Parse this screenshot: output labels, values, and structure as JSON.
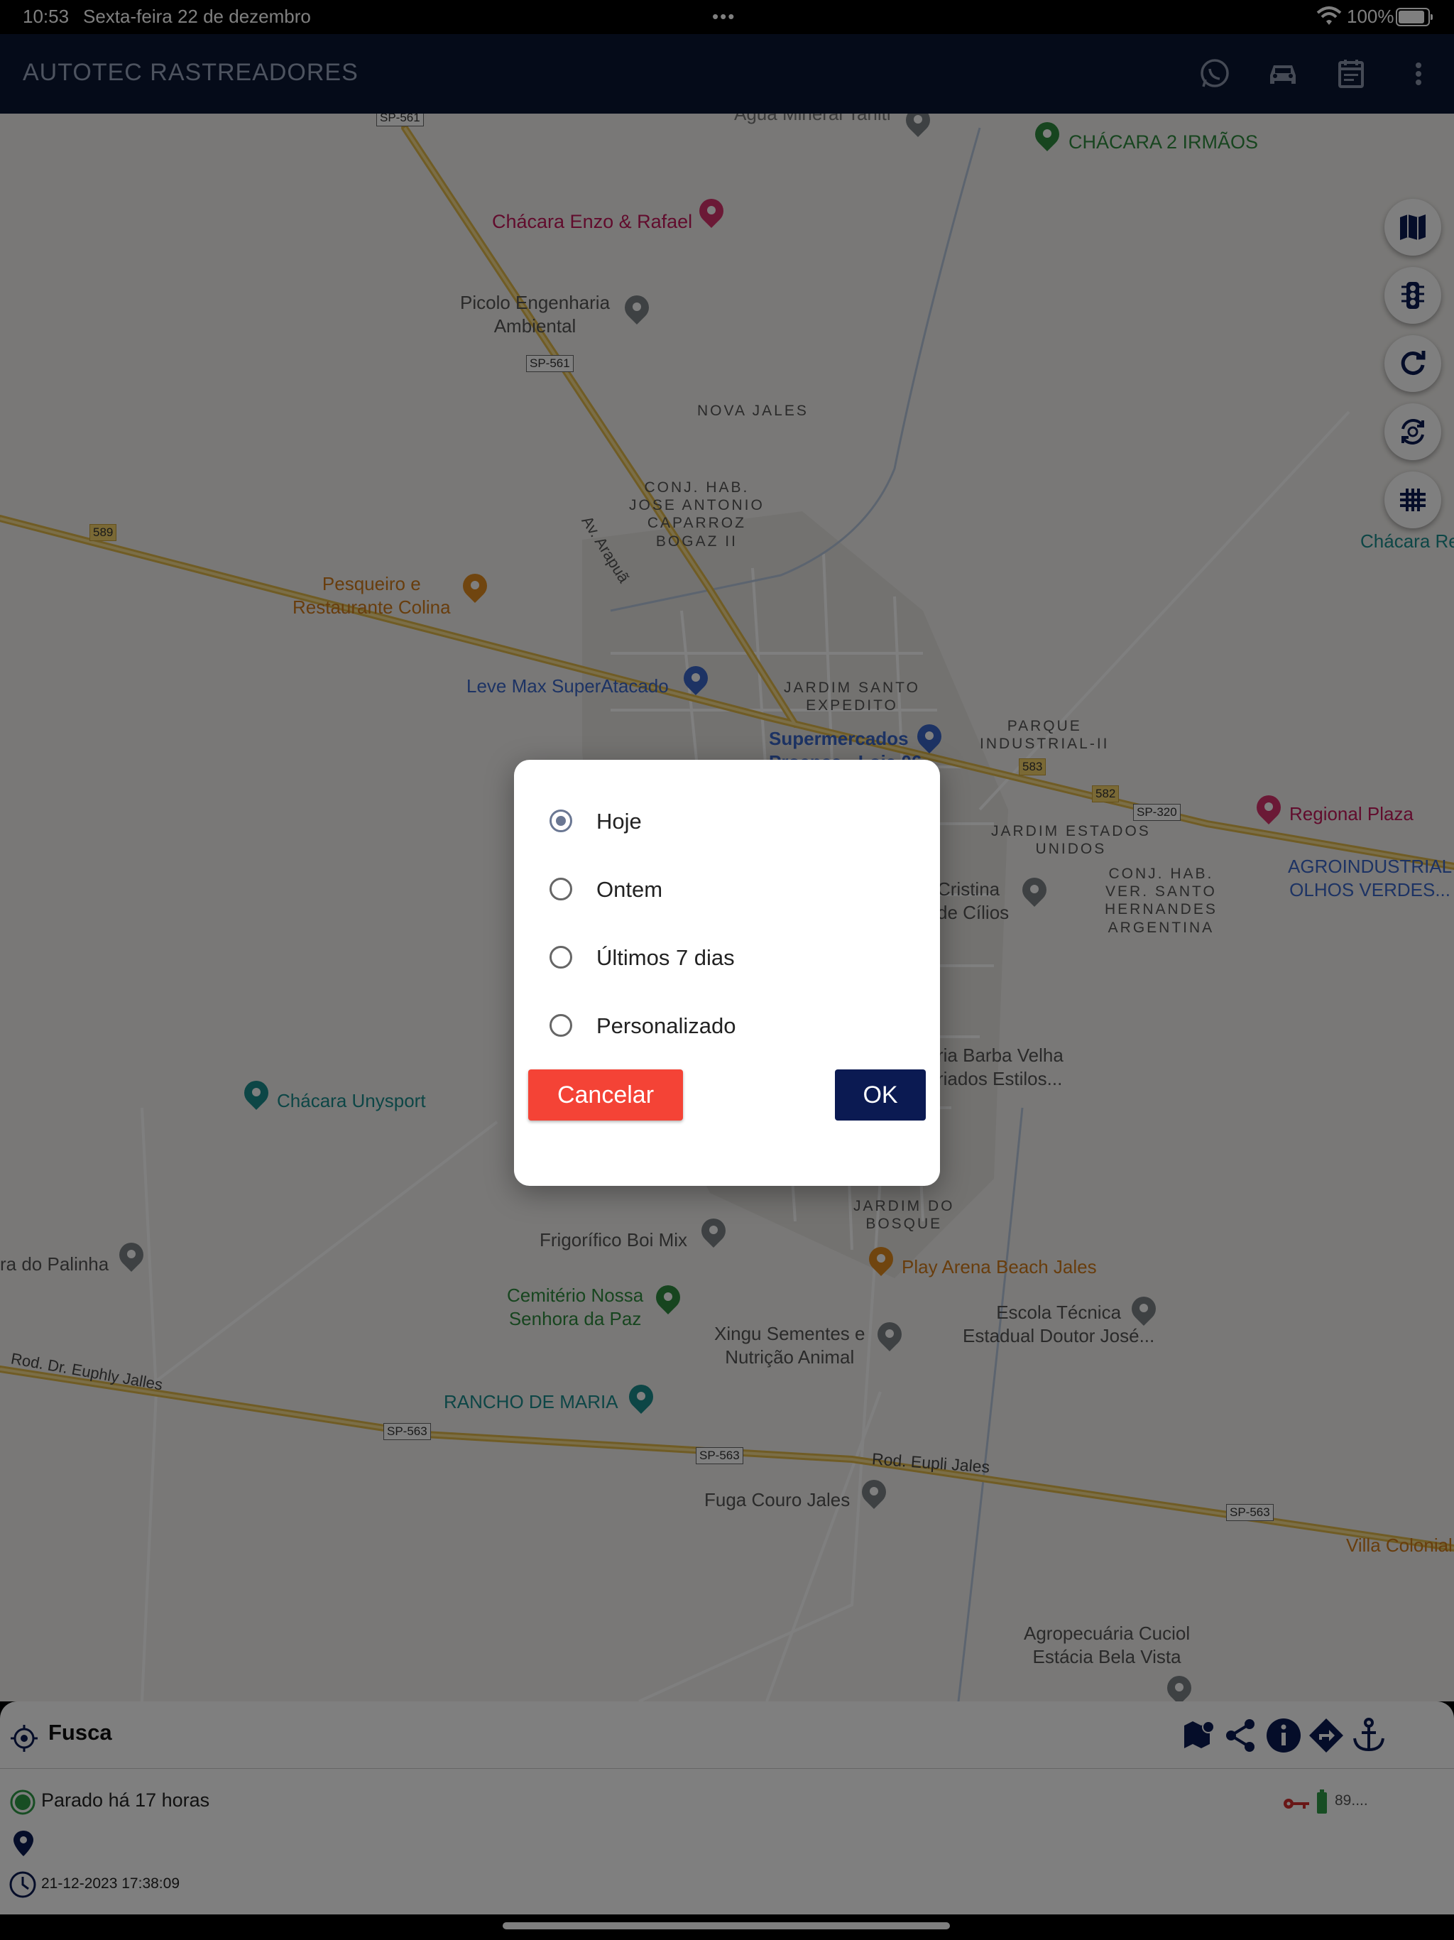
{
  "status_bar": {
    "time": "10:53",
    "date": "Sexta-feira 22 de dezembro",
    "dots": "•••",
    "battery_pct": "100%",
    "battery_level": 1.0
  },
  "app_bar": {
    "title": "AUTOTEC RASTREADORES",
    "actions": [
      "whatsapp-icon",
      "car-icon",
      "calendar-icon",
      "more-vert-icon"
    ]
  },
  "map": {
    "labels": {
      "agua": "Água Mineral Tahiti",
      "chacara_2irmaos": "CHÁCARA 2 IRMÃOS",
      "chacara_enzo": "Chácara Enzo & Rafael",
      "picolo": "Picolo Engenharia\nAmbiental",
      "nova_jales": "NOVA JALES",
      "av_arapua": "Av. Arapuã",
      "conj_hab": "CONJ. HAB.\nJOSE ANTONIO\nCAPARROZ\nBOGAZ II",
      "pesqueiro": "Pesqueiro e\nRestaurante Colina",
      "leve_max": "Leve Max SuperAtacado",
      "jardim_santo": "JARDIM SANTO\nEXPEDITO",
      "supermercados": "Supermercados\nProença - Loja 06",
      "parque_ind": "PARQUE\nINDUSTRIAL-II",
      "jardim_estados": "JARDIM ESTADOS\nUNIDOS",
      "regional": "Regional Plaza",
      "agroindustrial": "AGROINDUSTRIAL\nOLHOS VERDES...",
      "conj_ver": "CONJ. HAB.\nVER. SANTO\nHERNANDES\nARGENTINA",
      "cristina": "Cristina\nde Cílios",
      "barba": "ria Barba Velha\nriados Estilos...",
      "chacara_unysport": "Chácara Unysport",
      "chacara_re": "Chácara Re",
      "palinha": "ra do Palinha",
      "frigorifico": "Frigorífico Boi Mix",
      "jardim_bosque": "JARDIM DO\nBOSQUE",
      "play_arena": "Play Arena Beach Jales",
      "cemiterio": "Cemitério Nossa\nSenhora da Paz",
      "escola": "Escola Técnica\nEstadual Doutor José...",
      "xingu": "Xingu Sementes e\nNutrição Animal",
      "rod_euphly": "Rod. Dr. Euphly Jalles",
      "rancho": "RANCHO DE MARIA",
      "rod_eupli": "Rod. Eupli Jales",
      "fuga": "Fuga Couro Jales",
      "villa": "Villa Colonial",
      "agropecuaria": "Agropecuária Cuciol\nEstácia Bela Vista"
    },
    "shields": {
      "sp561_a": "SP-561",
      "sp561_b": "SP-561",
      "r589": "589",
      "r583": "583",
      "r582": "582",
      "sp320": "SP-320",
      "sp563_a": "SP-563",
      "sp563_b": "SP-563",
      "sp563_c": "SP-563"
    },
    "controls": [
      "map-layers-icon",
      "traffic-light-icon",
      "refresh-icon",
      "auto-refresh-icon",
      "grid-icon"
    ]
  },
  "vehicle_sheet": {
    "name": "Fusca",
    "status": "Parado há 17 horas",
    "timestamp": "21-12-2023 17:38:09",
    "battery": "89....",
    "actions": [
      "route-map-icon",
      "share-icon",
      "info-icon",
      "directions-icon",
      "anchor-icon"
    ]
  },
  "dialog": {
    "options": [
      {
        "label": "Hoje",
        "selected": true
      },
      {
        "label": "Ontem",
        "selected": false
      },
      {
        "label": "Últimos 7 dias",
        "selected": false
      },
      {
        "label": "Personalizado",
        "selected": false
      }
    ],
    "cancel_label": "Cancelar",
    "ok_label": "OK"
  },
  "colors": {
    "app_bar": "#0b1733",
    "ok_button": "#0b1a52",
    "cancel_button": "#f44336",
    "radio_selected": "#6a7793"
  }
}
